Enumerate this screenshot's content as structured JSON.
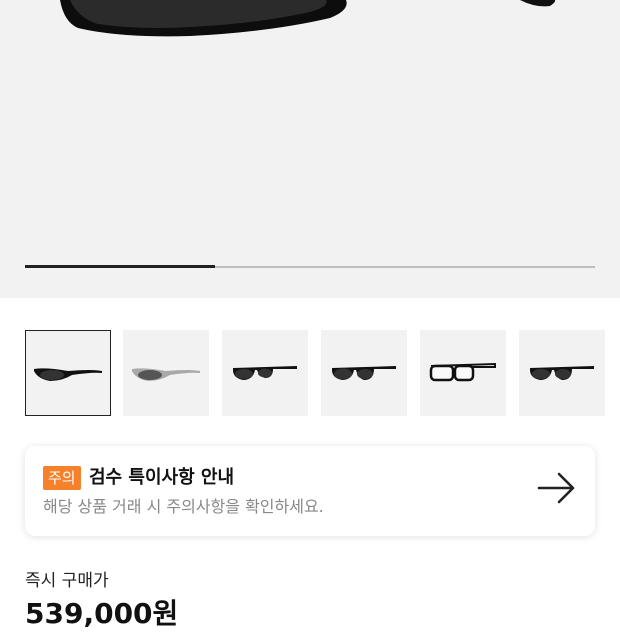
{
  "hero": {
    "image": "sunglasses-main",
    "slide_progress": 0.33
  },
  "thumbnails": [
    {
      "name": "thumb-1",
      "selected": true
    },
    {
      "name": "thumb-2",
      "selected": false
    },
    {
      "name": "thumb-3",
      "selected": false
    },
    {
      "name": "thumb-4",
      "selected": false
    },
    {
      "name": "thumb-5",
      "selected": false
    },
    {
      "name": "thumb-6",
      "selected": false
    }
  ],
  "notice": {
    "badge": "주의",
    "title": "검수 특이사항 안내",
    "subtitle": "해당 상품 거래 시 주의사항을 확인하세요.",
    "arrow_icon": "arrow-right-icon"
  },
  "price": {
    "label": "즉시 구매가",
    "value": "539,000원"
  }
}
